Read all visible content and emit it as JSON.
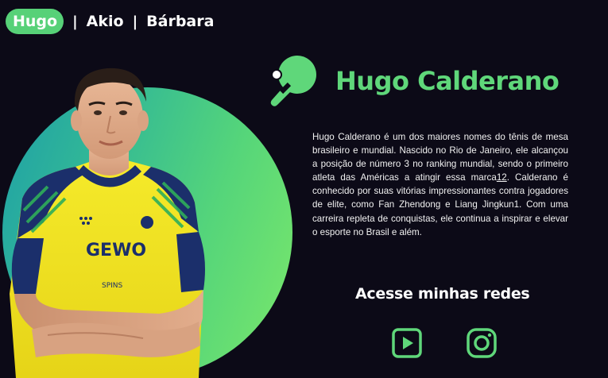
{
  "nav": {
    "items": [
      {
        "label": "Hugo",
        "active": true
      },
      {
        "label": "Akio",
        "active": false
      },
      {
        "label": "Bárbara",
        "active": false
      }
    ],
    "separator": "|"
  },
  "hero": {
    "player_name": "Hugo Calderano",
    "icon": "ping-pong-paddle-icon"
  },
  "bio": {
    "text_1": "Hugo Calderano é um dos maiores nomes do tênis de mesa brasileiro e mundial. Nascido no Rio de Janeiro, ele alcançou a posição de número 3 no ranking mundial, sendo o primeiro atleta das Américas a atingir essa marca",
    "ref_1": "12",
    "text_2": ". Calderano é conhecido por suas vitórias impressionantes contra jogadores de elite, como Fan Zhendong e Liang Jingkun",
    "ref_2": "1",
    "text_3": ". Com uma carreira repleta de conquistas, ele continua a inspirar e elevar o esporte no Brasil e além."
  },
  "social": {
    "title": "Acesse minhas redes",
    "links": [
      {
        "icon": "youtube-icon"
      },
      {
        "icon": "instagram-icon"
      }
    ]
  },
  "jersey": {
    "brand": "GEWO",
    "sponsor_small": "SPINS"
  },
  "colors": {
    "background": "#0c0a17",
    "accent": "#57d178",
    "title": "#5fd77a",
    "jersey_yellow": "#f2e51f",
    "jersey_navy": "#1b2f6b"
  }
}
